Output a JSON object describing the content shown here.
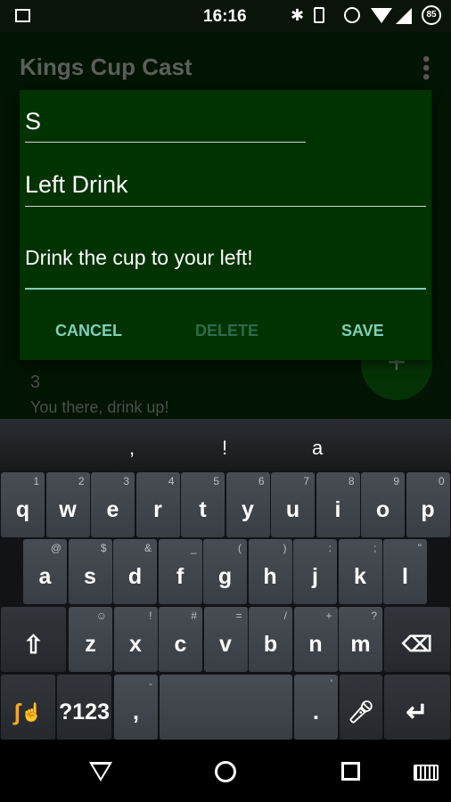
{
  "status_bar": {
    "time": "16:16",
    "battery": "85",
    "icons": [
      "image-icon",
      "bluetooth-icon",
      "vibrate-icon",
      "alarm-icon",
      "wifi-icon",
      "signal-icon",
      "battery-icon"
    ]
  },
  "app": {
    "title": "Kings Cup Cast",
    "list": [
      {
        "number": "3",
        "text": "You there, drink up!"
      }
    ],
    "fab": "+"
  },
  "dialog": {
    "card_value": "S",
    "title_value": "Left Drink",
    "description_value": "Drink the cup to your left!",
    "cancel": "CANCEL",
    "delete": "DELETE",
    "save": "SAVE",
    "accent": "#7fcfb8"
  },
  "keyboard": {
    "suggestions": [
      ",",
      "!",
      "a"
    ],
    "row1": [
      [
        "q",
        "1"
      ],
      [
        "w",
        "2"
      ],
      [
        "e",
        "3"
      ],
      [
        "r",
        "4"
      ],
      [
        "t",
        "5"
      ],
      [
        "y",
        "6"
      ],
      [
        "u",
        "7"
      ],
      [
        "i",
        "8"
      ],
      [
        "o",
        "9"
      ],
      [
        "p",
        "0"
      ]
    ],
    "row2": [
      [
        "a",
        "@"
      ],
      [
        "s",
        "$"
      ],
      [
        "d",
        "&"
      ],
      [
        "f",
        "_"
      ],
      [
        "g",
        "("
      ],
      [
        "h",
        ")"
      ],
      [
        "j",
        ":"
      ],
      [
        "k",
        ";"
      ],
      [
        "l",
        "\""
      ]
    ],
    "row3": [
      [
        "z",
        "☺"
      ],
      [
        "x",
        "!"
      ],
      [
        "c",
        "#"
      ],
      [
        "v",
        "="
      ],
      [
        "b",
        "/"
      ],
      [
        "n",
        "+"
      ],
      [
        "m",
        "?"
      ]
    ],
    "symbols_label": "?123",
    "comma": ",",
    "comma_hint": "-",
    "period": ".",
    "period_hint": "'"
  }
}
